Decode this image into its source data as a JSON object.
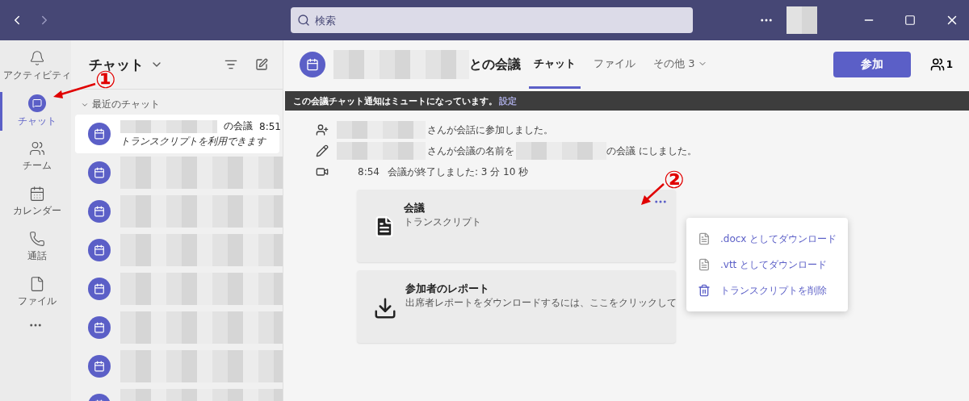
{
  "title_bar": {
    "search": {
      "placeholder": "検索"
    }
  },
  "rail": {
    "items": [
      {
        "label": "アクティビティ",
        "selected": false
      },
      {
        "label": "チャット",
        "selected": true
      },
      {
        "label": "チーム",
        "selected": false
      },
      {
        "label": "カレンダー",
        "selected": false
      },
      {
        "label": "通話",
        "selected": false
      },
      {
        "label": "ファイル",
        "selected": false
      }
    ]
  },
  "chat_list": {
    "title": "チャット",
    "section": "最近のチャット",
    "items": [
      {
        "selected": true,
        "name": "の会議",
        "time": "8:51",
        "preview": "トランスクリプトを利用できます"
      },
      {
        "selected": false
      },
      {
        "selected": false
      },
      {
        "selected": false
      },
      {
        "selected": false
      },
      {
        "selected": false
      },
      {
        "selected": false
      },
      {
        "selected": false
      }
    ]
  },
  "header": {
    "title": "との会議",
    "tabs": [
      {
        "label": "チャット",
        "selected": true
      },
      {
        "label": "ファイル",
        "selected": false
      },
      {
        "label": "その他 3",
        "selected": false
      }
    ],
    "join_button": "参加",
    "participants": "1"
  },
  "banner": {
    "text": "この会議チャット通知はミュートになっています。",
    "link": "設定"
  },
  "events": [
    {
      "kind": "joined",
      "text": "さんが会話に参加しました。"
    },
    {
      "kind": "renamed",
      "text": "さんが会議の名前を",
      "suffix": "の会議 にしました。"
    },
    {
      "kind": "ended",
      "time": "8:54",
      "text": "会議が終了しました: 3 分 10 秒"
    }
  ],
  "cards": [
    {
      "kind": "transcript",
      "title": "会議",
      "subtitle": "トランスクリプト"
    },
    {
      "kind": "report",
      "title": "参加者のレポート",
      "subtitle": "出席者レポートをダウンロードするには、ここをクリックして"
    }
  ],
  "menu": {
    "items": [
      {
        "kind": "file",
        "label": ".docx としてダウンロード"
      },
      {
        "kind": "file",
        "label": ".vtt としてダウンロード"
      },
      {
        "kind": "delete",
        "label": "トランスクリプトを削除"
      }
    ]
  },
  "annotations": [
    {
      "label": "①"
    },
    {
      "label": "②"
    }
  ]
}
